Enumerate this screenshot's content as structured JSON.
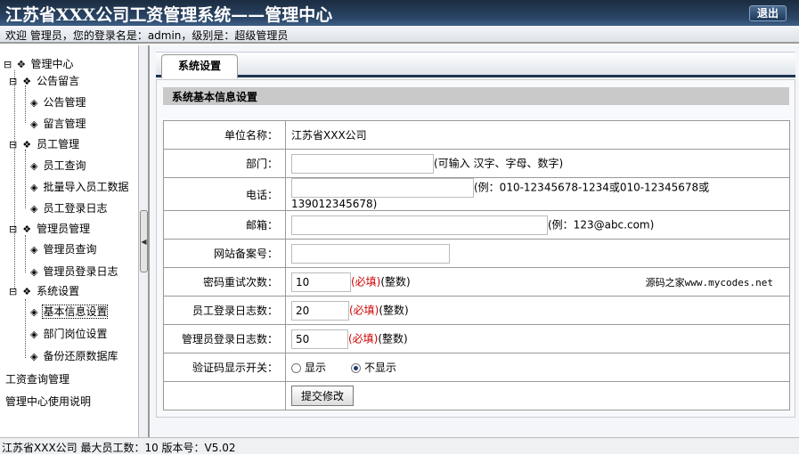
{
  "header": {
    "title": "江苏省XXX公司工资管理系统——管理中心",
    "logout": "退出"
  },
  "welcome": "欢迎 管理员，您的登录名是：admin，级别是：超级管理员",
  "sidebar": {
    "root": "管理中心",
    "groups": [
      {
        "label": "公告留言",
        "items": [
          "公告管理",
          "留言管理"
        ]
      },
      {
        "label": "员工管理",
        "items": [
          "员工查询",
          "批量导入员工数据",
          "员工登录日志"
        ]
      },
      {
        "label": "管理员管理",
        "items": [
          "管理员查询",
          "管理员登录日志"
        ]
      },
      {
        "label": "系统设置",
        "items": [
          "基本信息设置",
          "部门岗位设置",
          "备份还原数据库"
        ]
      }
    ],
    "links": [
      "工资查询管理",
      "管理中心使用说明"
    ]
  },
  "tab": "系统设置",
  "section": "系统基本信息设置",
  "form": {
    "unit_label": "单位名称：",
    "unit_value": "江苏省XXX公司",
    "dept_label": "部门：",
    "dept_hint": "(可输入 汉字、字母、数字)",
    "phone_label": "电话：",
    "phone_hint": "(例：010-12345678-1234或010-12345678或139012345678)",
    "email_label": "邮箱：",
    "email_hint": "(例：123@abc.com)",
    "icp_label": "网站备案号：",
    "pwd_label": "密码重试次数：",
    "pwd_value": "10",
    "emplog_label": "员工登录日志数：",
    "emplog_value": "20",
    "adminlog_label": "管理员登录日志数：",
    "adminlog_value": "50",
    "required": "(必填)",
    "integer": "(整数)",
    "watermark": "源码之家www.mycodes.net",
    "captcha_label": "验证码显示开关：",
    "show": "显示",
    "hide": "不显示",
    "captcha_selected": "不显示",
    "submit": "提交修改"
  },
  "status": "江苏省XXX公司  最大员工数：10 版本号：V5.02"
}
